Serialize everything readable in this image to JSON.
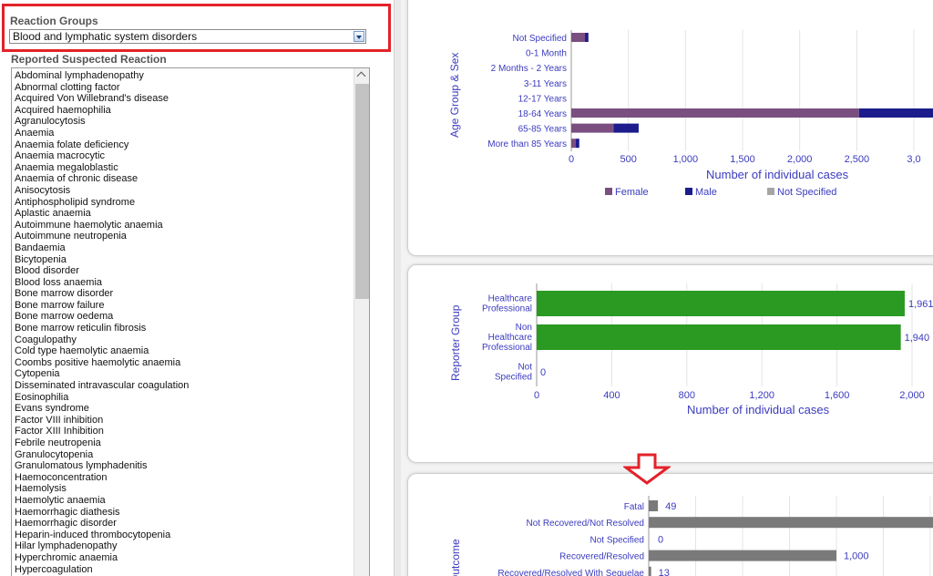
{
  "filters": {
    "reaction_groups_label": "Reaction Groups",
    "reaction_groups_value": "Blood and lymphatic system disorders",
    "reported_reaction_label": "Reported Suspected Reaction",
    "reactions": [
      "Abdominal lymphadenopathy",
      "Abnormal clotting factor",
      "Acquired Von Willebrand's disease",
      "Acquired haemophilia",
      "Agranulocytosis",
      "Anaemia",
      "Anaemia folate deficiency",
      "Anaemia macrocytic",
      "Anaemia megaloblastic",
      "Anaemia of chronic disease",
      "Anisocytosis",
      "Antiphospholipid syndrome",
      "Aplastic anaemia",
      "Autoimmune haemolytic anaemia",
      "Autoimmune neutropenia",
      "Bandaemia",
      "Bicytopenia",
      "Blood disorder",
      "Blood loss anaemia",
      "Bone marrow disorder",
      "Bone marrow failure",
      "Bone marrow oedema",
      "Bone marrow reticulin fibrosis",
      "Coagulopathy",
      "Cold type haemolytic anaemia",
      "Coombs positive haemolytic anaemia",
      "Cytopenia",
      "Disseminated intravascular coagulation",
      "Eosinophilia",
      "Evans syndrome",
      "Factor VIII inhibition",
      "Factor XIII Inhibition",
      "Febrile neutropenia",
      "Granulocytopenia",
      "Granulomatous lymphadenitis",
      "Haemoconcentration",
      "Haemolysis",
      "Haemolytic anaemia",
      "Haemorrhagic diathesis",
      "Haemorrhagic disorder",
      "Heparin-induced thrombocytopenia",
      "Hilar lymphadenopathy",
      "Hyperchromic anaemia",
      "Hypercoagulation"
    ]
  },
  "colors": {
    "female": "#7a4f80",
    "male": "#1c1c8c",
    "not_specified": "#a5a5a5",
    "reporter_bar": "#2a9a22",
    "outcome_bar": "#7a7a7a",
    "axis_text": "#3b3bbf",
    "highlight": "#e32229"
  },
  "chart_data": [
    {
      "type": "bar",
      "orientation": "horizontal",
      "stacked": true,
      "ylabel": "Age Group & Sex",
      "xlabel": "Number of individual cases",
      "categories": [
        "Not Specified",
        "0-1 Month",
        "2 Months - 2 Years",
        "3-11 Years",
        "12-17 Years",
        "18-64 Years",
        "65-85 Years",
        "More than 85 Years"
      ],
      "series": [
        {
          "name": "Female",
          "values": [
            120,
            0,
            0,
            0,
            0,
            2520,
            370,
            40
          ]
        },
        {
          "name": "Male",
          "values": [
            30,
            0,
            0,
            0,
            0,
            660,
            220,
            30
          ]
        },
        {
          "name": "Not Specified",
          "values": [
            0,
            0,
            0,
            0,
            0,
            0,
            0,
            0
          ]
        }
      ],
      "xticks": [
        "0",
        "500",
        "1,000",
        "1,500",
        "2,000",
        "2,500",
        "3,0"
      ],
      "xlim": [
        0,
        3000
      ],
      "legend_position": "bottom"
    },
    {
      "type": "bar",
      "orientation": "horizontal",
      "ylabel": "Reporter Group",
      "xlabel": "Number of individual cases",
      "categories": [
        [
          "Healthcare",
          "Professional"
        ],
        [
          "Non",
          "Healthcare",
          "Professional"
        ],
        [
          "Not",
          "Specified"
        ]
      ],
      "values": [
        1961,
        1940,
        0
      ],
      "value_labels": [
        "1,961",
        "1,940",
        "0"
      ],
      "xticks": [
        "0",
        "400",
        "800",
        "1,200",
        "1,600",
        "2,000"
      ],
      "xlim": [
        0,
        2000
      ]
    },
    {
      "type": "bar",
      "orientation": "horizontal",
      "ylabel": "Outcome",
      "categories": [
        "Fatal",
        "Not Recovered/Not Resolved",
        "Not Specified",
        "Recovered/Resolved",
        "Recovered/Resolved With Sequelae"
      ],
      "values": [
        49,
        1520,
        0,
        1000,
        13
      ],
      "value_labels": [
        "49",
        "",
        "0",
        "1,000",
        "13"
      ]
    }
  ]
}
